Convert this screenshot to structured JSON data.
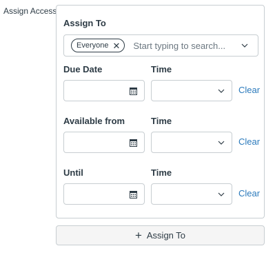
{
  "section_label": "Assign Access",
  "assign": {
    "title": "Assign To",
    "chip_label": "Everyone",
    "placeholder": "Start typing to search..."
  },
  "rows": [
    {
      "date_label": "Due Date",
      "time_label": "Time",
      "date_value": "",
      "time_value": "",
      "clear_label": "Clear"
    },
    {
      "date_label": "Available from",
      "time_label": "Time",
      "date_value": "",
      "time_value": "",
      "clear_label": "Clear"
    },
    {
      "date_label": "Until",
      "time_label": "Time",
      "date_value": "",
      "time_value": "",
      "clear_label": "Clear"
    }
  ],
  "add_button": {
    "label": "Assign To"
  },
  "icons": {
    "remove_chip": "x-icon",
    "dropdown": "chevron-down-icon",
    "calendar": "calendar-icon",
    "add": "plus-icon"
  },
  "colors": {
    "link": "#2b7abc",
    "border": "#c7cdd1",
    "text": "#2d3b45"
  }
}
